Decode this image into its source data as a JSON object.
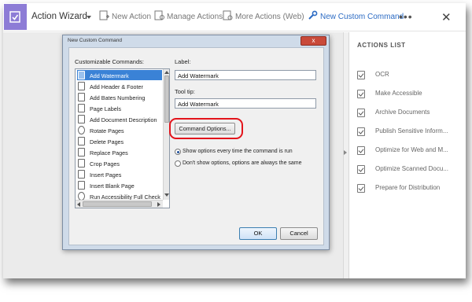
{
  "toolbar": {
    "title": "Action Wizard",
    "new_action": "New Action",
    "manage_actions": "Manage Actions",
    "more_actions": "More Actions (Web)",
    "new_custom_command": "New Custom Command",
    "more_menu": "•••",
    "close": "✕",
    "accent_color": "#8d7cd6",
    "link_color": "#2d6cc4"
  },
  "dialog": {
    "title": "New Custom Command",
    "close_glyph": "x",
    "customizable_label": "Customizable Commands:",
    "commands": [
      "Add Watermark",
      "Add Header & Footer",
      "Add Bates Numbering",
      "Page Labels",
      "Add Document Description",
      "Rotate Pages",
      "Delete Pages",
      "Replace Pages",
      "Crop Pages",
      "Insert Pages",
      "Insert Blank Page",
      "Run Accessibility Full Check"
    ],
    "selected_command": "Add Watermark",
    "label_caption": "Label:",
    "label_value": "Add Watermark",
    "tooltip_caption": "Tool tip:",
    "tooltip_value": "Add Watermark",
    "command_options": "Command Options...",
    "radio_show": "Show options every time the command is run",
    "radio_dont_show": "Don't show options, options are always the same",
    "radio_selected": "show",
    "ok": "OK",
    "cancel": "Cancel"
  },
  "actions_list": {
    "title": "ACTIONS LIST",
    "items": [
      "OCR",
      "Make Accessible",
      "Archive Documents",
      "Publish Sensitive Inform...",
      "Optimize for Web and M...",
      "Optimize Scanned Docu...",
      "Prepare for Distribution"
    ]
  }
}
